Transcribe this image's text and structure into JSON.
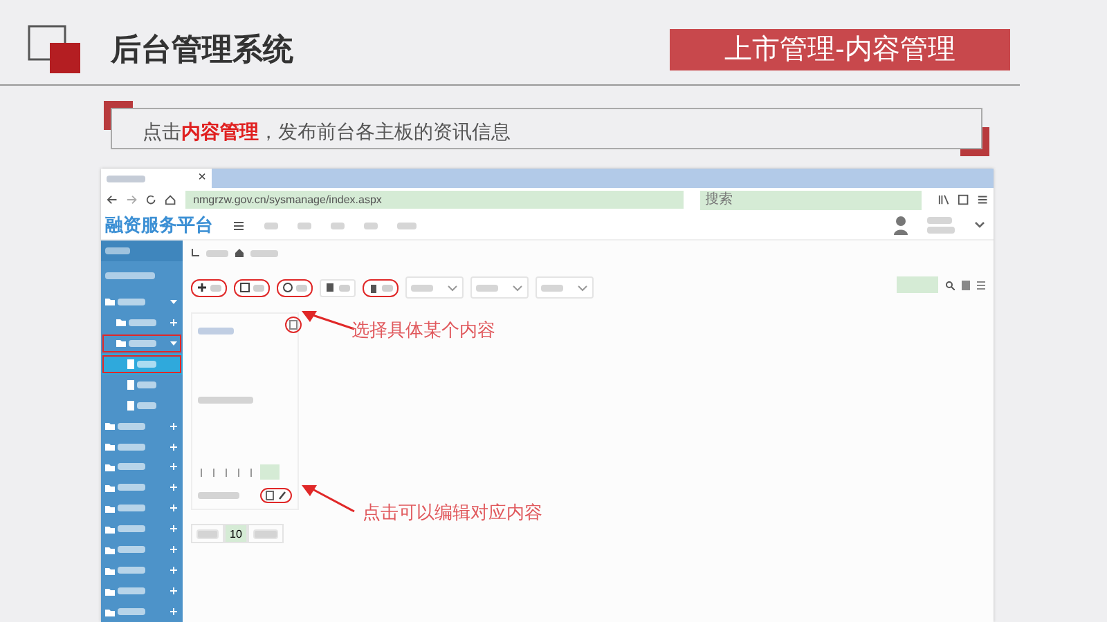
{
  "slide": {
    "title": "后台管理系统",
    "section": "上市管理-内容管理",
    "instruction": "点击**内容管理**，发布前台各主板的资讯信息"
  },
  "browser": {
    "tab": {
      "close": "×"
    },
    "url": "nmgrzw.gov.cn/sysmanage/index.aspx",
    "search": {
      "placeholder": "搜索"
    }
  },
  "app": {
    "brand": "融资服务平台",
    "sidebar": [
      {
        "kind": "header"
      },
      {
        "kind": "user"
      },
      {
        "kind": "group",
        "expanded": true,
        "circled": false,
        "children": [
          {
            "kind": "group",
            "expanded": false,
            "circled": false
          },
          {
            "kind": "group",
            "expanded": true,
            "circled": true,
            "children": [
              {
                "kind": "page",
                "selected": true,
                "circled": true
              },
              {
                "kind": "page",
                "selected": false,
                "circled": false
              },
              {
                "kind": "page",
                "selected": false,
                "circled": false
              }
            ]
          }
        ]
      },
      {
        "kind": "group",
        "expanded": false,
        "circled": false
      },
      {
        "kind": "group",
        "expanded": false,
        "circled": false
      },
      {
        "kind": "group",
        "expanded": false,
        "circled": false
      },
      {
        "kind": "group",
        "expanded": false,
        "circled": false
      },
      {
        "kind": "group",
        "expanded": false,
        "circled": false
      },
      {
        "kind": "group",
        "expanded": false,
        "circled": false
      },
      {
        "kind": "group",
        "expanded": false,
        "circled": false
      },
      {
        "kind": "group",
        "expanded": false,
        "circled": false
      },
      {
        "kind": "group",
        "expanded": false,
        "circled": false
      },
      {
        "kind": "group",
        "expanded": false,
        "circled": false
      }
    ],
    "toolbar": [
      {
        "kind": "add",
        "circled": true
      },
      {
        "kind": "save",
        "circled": true
      },
      {
        "kind": "audit",
        "circled": true
      },
      {
        "kind": "copy",
        "circled": false
      },
      {
        "kind": "delete",
        "circled": true
      },
      {
        "kind": "dropdown",
        "circled": false
      },
      {
        "kind": "dropdown",
        "circled": false
      },
      {
        "kind": "dropdown",
        "circled": false
      }
    ],
    "page_size": "10"
  },
  "annotations": [
    {
      "kind": "select",
      "text": "选择具体某个内容"
    },
    {
      "kind": "edit",
      "text": "点击可以编辑对应内容"
    }
  ]
}
